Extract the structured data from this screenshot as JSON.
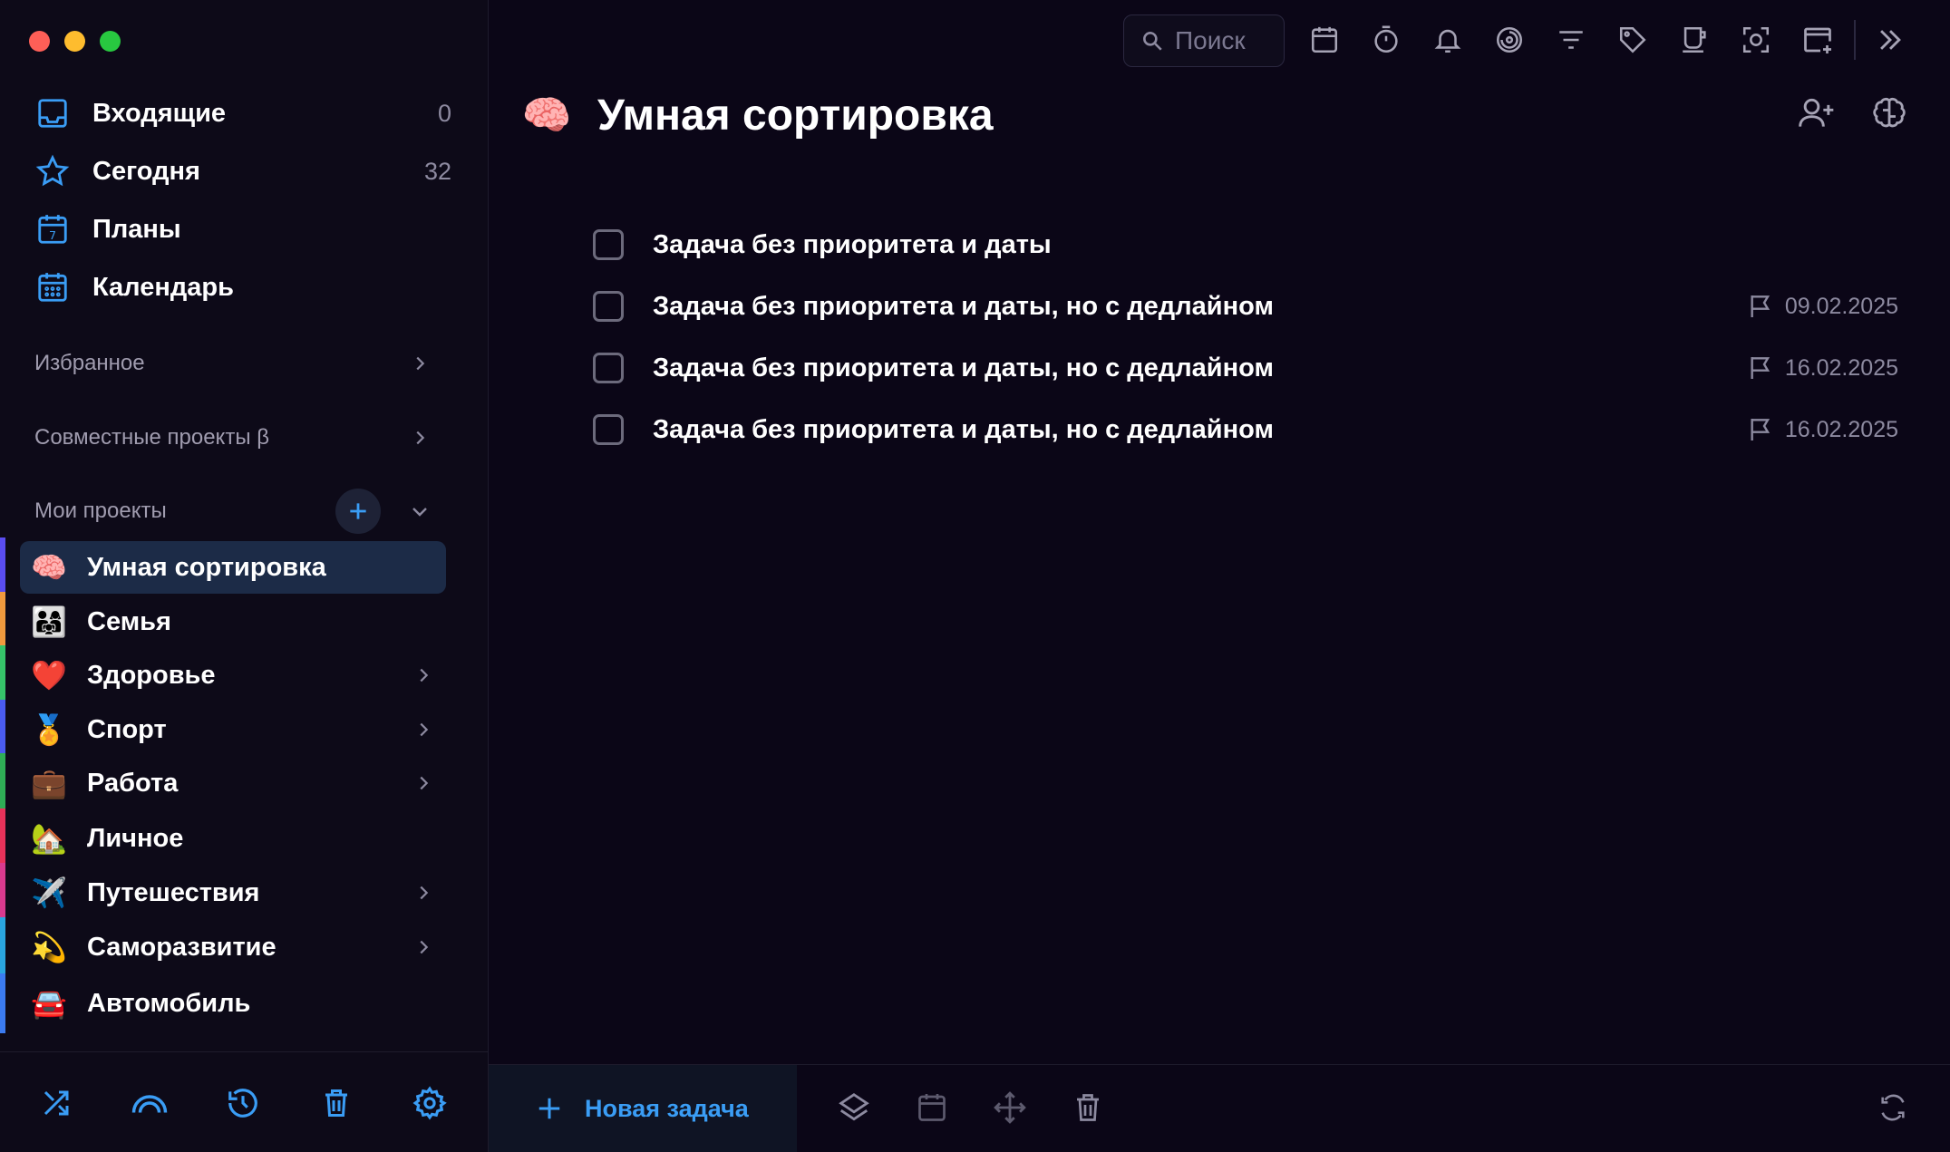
{
  "sidebar": {
    "nav": [
      {
        "label": "Входящие",
        "count": "0",
        "icon": "inbox-icon"
      },
      {
        "label": "Сегодня",
        "count": "32",
        "icon": "star-icon"
      },
      {
        "label": "Планы",
        "count": "",
        "icon": "calendar-day-icon"
      },
      {
        "label": "Календарь",
        "count": "",
        "icon": "calendar-grid-icon"
      }
    ],
    "sections": {
      "favorites": "Избранное",
      "shared": "Совместные проекты β",
      "my_projects": "Мои проекты"
    },
    "projects": [
      {
        "emoji": "🧠",
        "label": "Умная сортировка",
        "color": "#5a4df0",
        "active": true,
        "has_children": false
      },
      {
        "emoji": "👨‍👩‍👧",
        "label": "Семья",
        "color": "#f09a3e",
        "active": false,
        "has_children": false
      },
      {
        "emoji": "❤️",
        "label": "Здоровье",
        "color": "#36c46a",
        "active": false,
        "has_children": true
      },
      {
        "emoji": "🏅",
        "label": "Спорт",
        "color": "#4a5cf0",
        "active": false,
        "has_children": true
      },
      {
        "emoji": "💼",
        "label": "Работа",
        "color": "#2fae56",
        "active": false,
        "has_children": true
      },
      {
        "emoji": "🏡",
        "label": "Личное",
        "color": "#e8325a",
        "active": false,
        "has_children": false
      },
      {
        "emoji": "✈️",
        "label": "Путешествия",
        "color": "#d93a8e",
        "active": false,
        "has_children": true
      },
      {
        "emoji": "💫",
        "label": "Саморазвитие",
        "color": "#2aa6e0",
        "active": false,
        "has_children": true
      },
      {
        "emoji": "🚘",
        "label": "Автомобиль",
        "color": "#3b7bf0",
        "active": false,
        "has_children": false
      }
    ],
    "footer_icons": [
      "shuffle-icon",
      "rainbow-icon",
      "history-icon",
      "trash-icon",
      "settings-icon"
    ]
  },
  "toolbar": {
    "search_placeholder": "Поиск",
    "icons": [
      "calendar-icon",
      "stopwatch-icon",
      "bell-icon",
      "focus-icon",
      "filter-icon",
      "tag-icon",
      "cup-icon",
      "scan-icon",
      "add-window-icon",
      "expand-icon"
    ]
  },
  "main": {
    "emoji": "🧠",
    "title": "Умная сортировка",
    "header_icons": [
      "add-member-icon",
      "brain-icon"
    ],
    "tasks": [
      {
        "text": "Задача без приоритета и даты",
        "deadline": ""
      },
      {
        "text": "Задача без приоритета и даты, но с дедлайном",
        "deadline": "09.02.2025"
      },
      {
        "text": "Задача без приоритета и даты, но с дедлайном",
        "deadline": "16.02.2025"
      },
      {
        "text": "Задача без приоритета и даты, но с дедлайном",
        "deadline": "16.02.2025"
      }
    ]
  },
  "bottom_bar": {
    "new_task_label": "Новая задача",
    "icons": [
      "layers-icon",
      "calendar-icon",
      "move-icon",
      "trash-icon",
      "sync-icon"
    ]
  },
  "colors": {
    "background": "#0b0617",
    "sidebar": "#0d0a18",
    "accent": "#3a9df5",
    "active_item": "#1c2b47"
  }
}
